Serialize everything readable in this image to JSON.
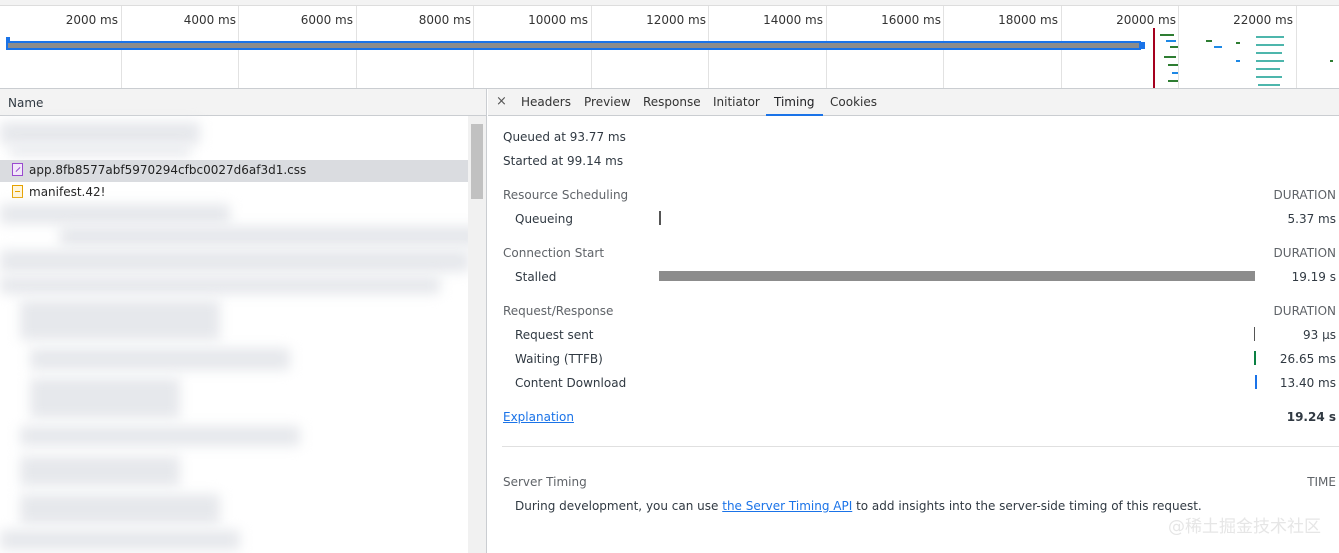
{
  "overview": {
    "ticks": [
      "2000 ms",
      "4000 ms",
      "6000 ms",
      "8000 ms",
      "10000 ms",
      "12000 ms",
      "14000 ms",
      "16000 ms",
      "18000 ms",
      "20000 ms",
      "22000 ms"
    ]
  },
  "left": {
    "column_header": "Name",
    "selected_file": "app.8fb8577abf5970294cfbc0027d6af3d1.css",
    "next_file": "manifest.42!"
  },
  "tabs": {
    "close": "×",
    "items": [
      "Headers",
      "Preview",
      "Response",
      "Initiator",
      "Timing",
      "Cookies"
    ],
    "active": "Timing"
  },
  "timing": {
    "queued": "Queued at 93.77 ms",
    "started": "Started at 99.14 ms",
    "sections": {
      "scheduling": {
        "title": "Resource Scheduling",
        "duration_label": "DURATION",
        "rows": [
          {
            "label": "Queueing",
            "value": "5.37 ms"
          }
        ]
      },
      "connection": {
        "title": "Connection Start",
        "duration_label": "DURATION",
        "rows": [
          {
            "label": "Stalled",
            "value": "19.19 s"
          }
        ]
      },
      "request": {
        "title": "Request/Response",
        "duration_label": "DURATION",
        "rows": [
          {
            "label": "Request sent",
            "value": "93 µs"
          },
          {
            "label": "Waiting (TTFB)",
            "value": "26.65 ms"
          },
          {
            "label": "Content Download",
            "value": "13.40 ms"
          }
        ]
      }
    },
    "explanation": "Explanation",
    "total": "19.24 s",
    "server_timing": {
      "title": "Server Timing",
      "time_label": "TIME",
      "text_before": "During development, you can use ",
      "link": "the Server Timing API",
      "text_after": " to add insights into the server-side timing of this request."
    }
  },
  "watermark": "@稀土掘金技术社区",
  "colors": {
    "accent": "#1a73e8",
    "stalled_bar": "#8c8c8c",
    "queueing_bar": "#555555",
    "request_bar": "#0b8043",
    "download_bar": "#1a73e8",
    "finish_marker": "#a5001e"
  }
}
